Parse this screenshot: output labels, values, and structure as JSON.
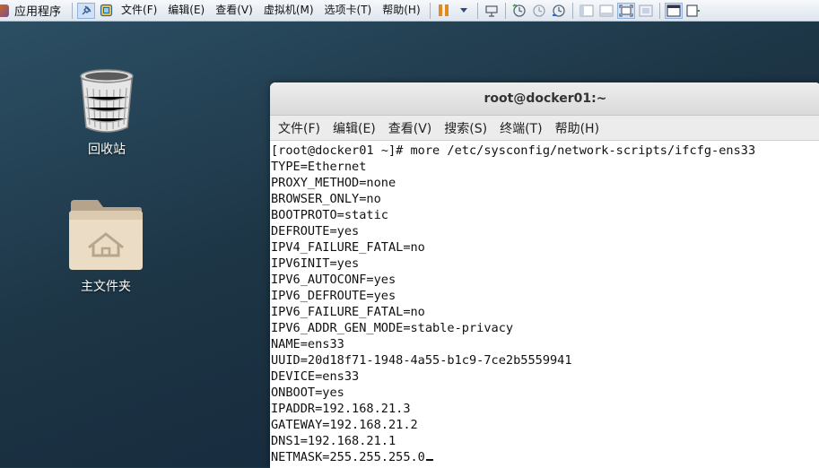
{
  "host_toolbar": {
    "apps_menu_label": "应用程序",
    "menus": [
      "文件(F)",
      "编辑(E)",
      "查看(V)",
      "虚拟机(M)",
      "选项卡(T)",
      "帮助(H)"
    ]
  },
  "desktop": {
    "icons": [
      {
        "label": "回收站",
        "icon": "trash-icon"
      },
      {
        "label": "主文件夹",
        "icon": "home-folder-icon"
      }
    ]
  },
  "terminal": {
    "title": "root@docker01:~",
    "menus": [
      "文件(F)",
      "编辑(E)",
      "查看(V)",
      "搜索(S)",
      "终端(T)",
      "帮助(H)"
    ],
    "lines": [
      "[root@docker01 ~]# more /etc/sysconfig/network-scripts/ifcfg-ens33",
      "TYPE=Ethernet",
      "PROXY_METHOD=none",
      "BROWSER_ONLY=no",
      "BOOTPROTO=static",
      "DEFROUTE=yes",
      "IPV4_FAILURE_FATAL=no",
      "IPV6INIT=yes",
      "IPV6_AUTOCONF=yes",
      "IPV6_DEFROUTE=yes",
      "IPV6_FAILURE_FATAL=no",
      "IPV6_ADDR_GEN_MODE=stable-privacy",
      "NAME=ens33",
      "UUID=20d18f71-1948-4a55-b1c9-7ce2b5559941",
      "DEVICE=ens33",
      "ONBOOT=yes",
      "IPADDR=192.168.21.3",
      "GATEWAY=192.168.21.2",
      "DNS1=192.168.21.1",
      "NETMASK=255.255.255.0"
    ]
  }
}
